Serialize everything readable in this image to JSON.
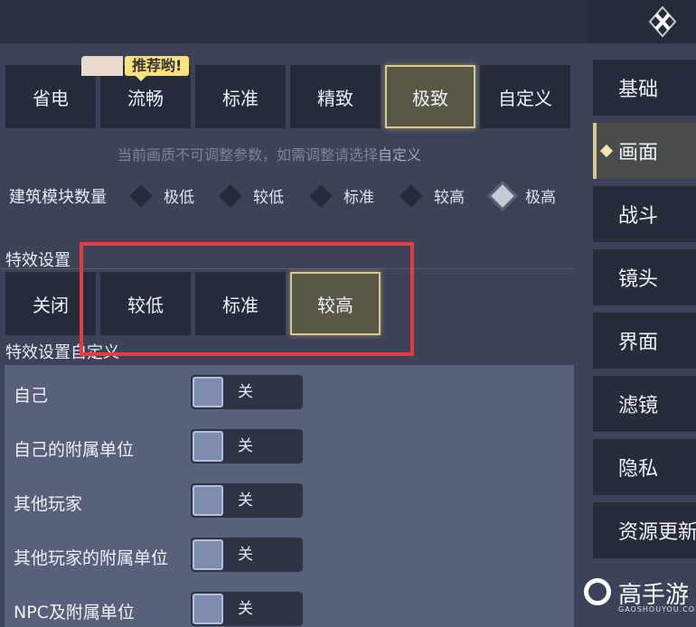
{
  "quality": {
    "options": [
      "省电",
      "流畅",
      "标准",
      "精致",
      "极致",
      "自定义"
    ],
    "selected": "极致",
    "recommend_badge": "推荐哟!"
  },
  "hint": {
    "text": "当前画质不可调整参数，如需调整请选择",
    "highlight": "自定义"
  },
  "building": {
    "label": "建筑模块数量",
    "options": [
      "极低",
      "较低",
      "标准",
      "较高",
      "极高"
    ],
    "selected": "极高"
  },
  "effects": {
    "label": "特效设置",
    "options": [
      "关闭",
      "较低",
      "标准",
      "较高"
    ],
    "selected": "较高",
    "custom_label": "特效设置自定义"
  },
  "custom_rows": [
    {
      "label": "自己",
      "value": "关"
    },
    {
      "label": "自己的附属单位",
      "value": "关"
    },
    {
      "label": "其他玩家",
      "value": "关"
    },
    {
      "label": "其他玩家的附属单位",
      "value": "关"
    },
    {
      "label": "NPC及附属单位",
      "value": "关"
    }
  ],
  "sidebar": {
    "items": [
      "基础",
      "画面",
      "战斗",
      "镜头",
      "界面",
      "滤镜",
      "隐私",
      "资源更新"
    ],
    "active": "画面"
  },
  "watermark": {
    "text": "高手游",
    "url_text": "GAOSHOUYOU.COM"
  },
  "colors": {
    "accent": "#d9c98a",
    "highlight_box": "#e83b3b",
    "badge": "#fae27b"
  },
  "icons": {
    "close": "close-icon",
    "diamond": "diamond-radio-icon"
  }
}
